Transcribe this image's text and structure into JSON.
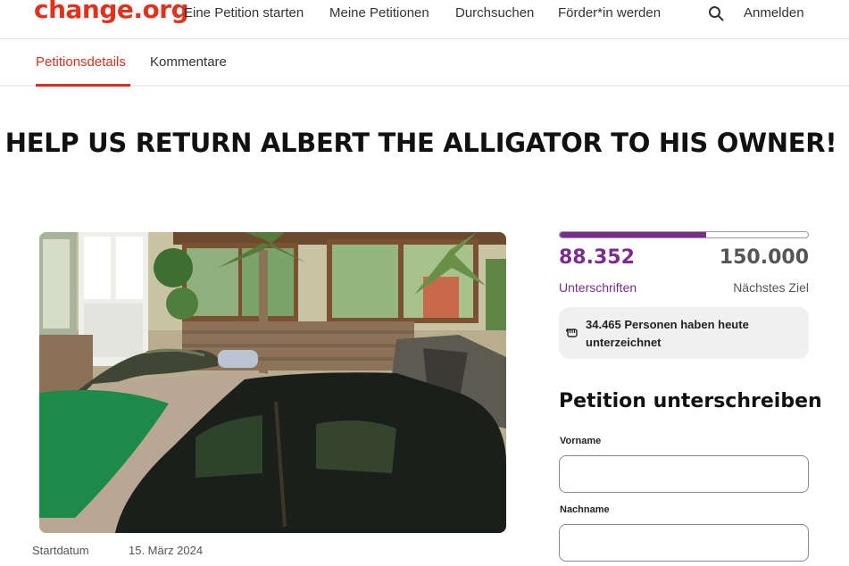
{
  "header": {
    "logo": "change.org",
    "nav": [
      "Eine Petition starten",
      "Meine Petitionen",
      "Durchsuchen",
      "Förder*in werden"
    ],
    "search_icon": "search-icon",
    "login": "Anmelden"
  },
  "tabs": [
    {
      "label": "Petitionsdetails",
      "active": true
    },
    {
      "label": "Kommentare",
      "active": false
    }
  ],
  "petition": {
    "title": "HELP US RETURN ALBERT THE ALLIGATOR TO HIS OWNER!",
    "start_label": "Startdatum",
    "start_date": "15. März 2024"
  },
  "stats": {
    "signatures": "88.352",
    "signatures_label": "Unterschriften",
    "goal": "150.000",
    "goal_label": "Nächstes Ziel",
    "progress_fraction": 0.589,
    "today_text": "34.465 Personen haben heute unterzeichnet",
    "today_icon": "fist-icon"
  },
  "form": {
    "heading": "Petition unterschreiben",
    "first_name_label": "Vorname",
    "first_name_value": "",
    "last_name_label": "Nachname",
    "last_name_value": ""
  },
  "colors": {
    "brand": "#e0321c",
    "accent_purple": "#7a2c8f",
    "tab_active": "#d3321f"
  }
}
